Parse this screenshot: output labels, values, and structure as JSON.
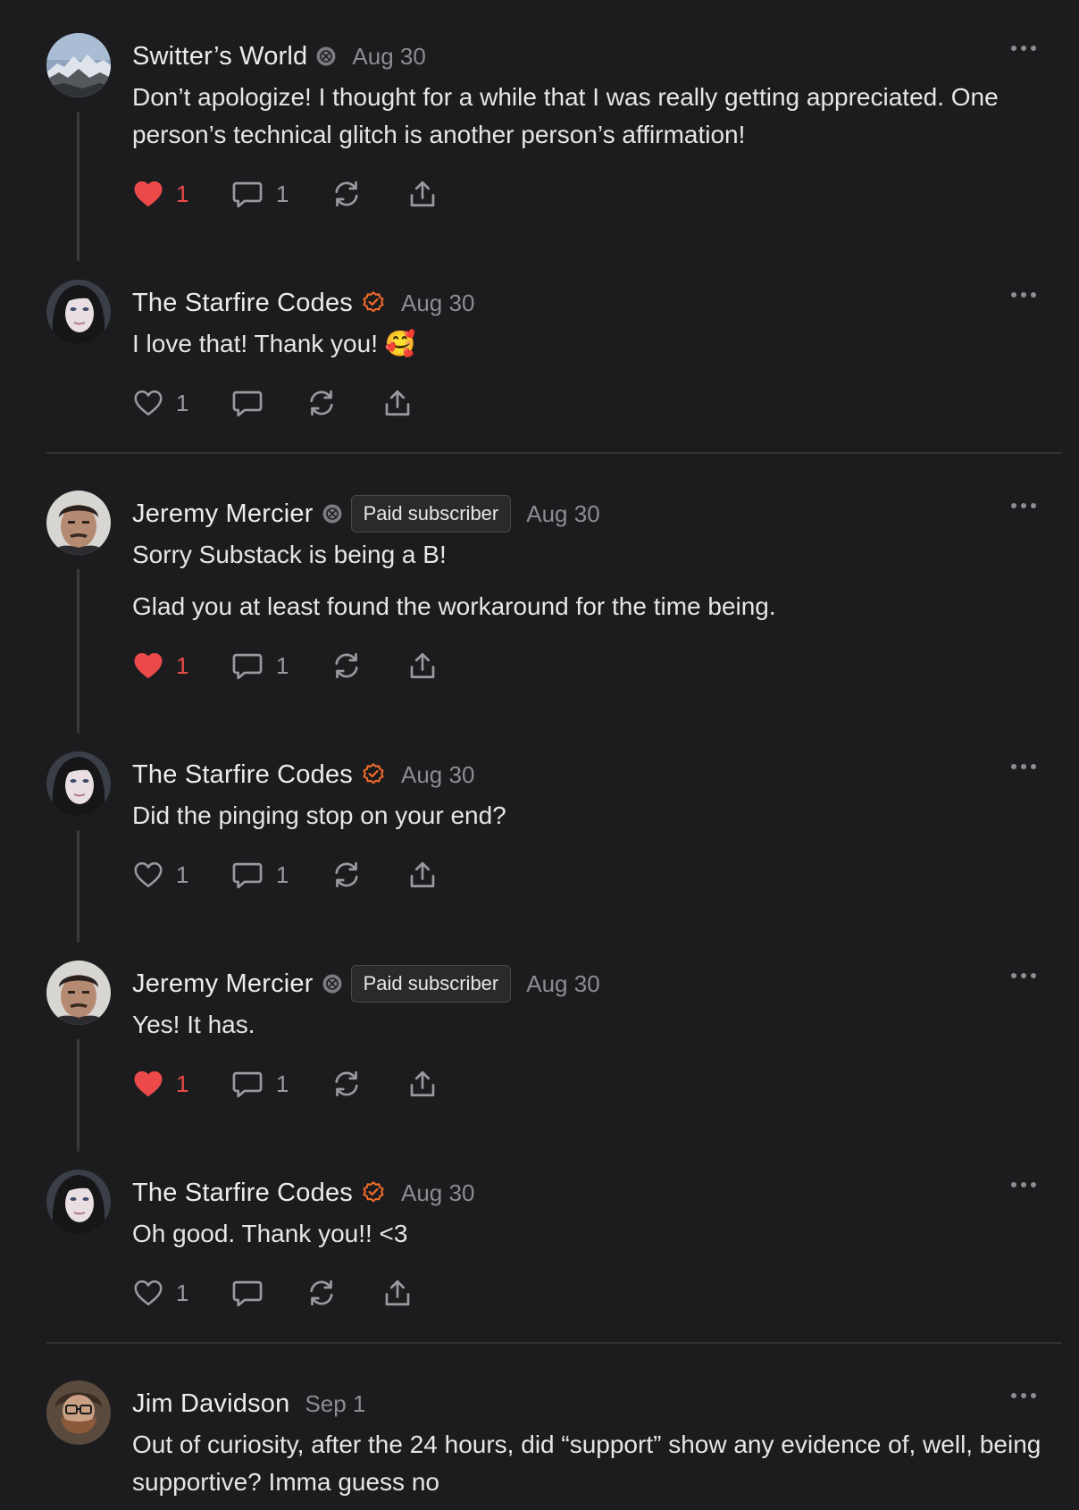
{
  "colors": {
    "background": "#1c1c1e",
    "like_active": "#ec4a4a",
    "verified": "#f06a2a",
    "muted": "#8d8d91"
  },
  "icons": {
    "like": "heart-icon",
    "comment": "speech-bubble-icon",
    "restack": "restack-arrows-icon",
    "share": "share-upload-icon",
    "more": "ellipsis-icon",
    "verified": "verified-check-icon",
    "creator_badge": "substack-badge-icon"
  },
  "comments": [
    {
      "author": "Switter’s World",
      "date": "Aug 30",
      "badge": "substack",
      "body": [
        "Don’t apologize! I thought for a while that I was really getting appreciated. One person’s technical glitch is another person’s affirmation!"
      ],
      "likes": "1",
      "liked": true,
      "replies": "1"
    },
    {
      "author": "The Starfire Codes",
      "date": "Aug 30",
      "badge": "verified",
      "body": [
        "I love that! Thank you! 🥰"
      ],
      "likes": "1",
      "liked": false
    },
    {
      "author": "Jeremy Mercier",
      "date": "Aug 30",
      "badge": "substack",
      "pill": "Paid subscriber",
      "body": [
        "Sorry Substack is being a B!",
        "Glad you at least found the workaround for the time being."
      ],
      "likes": "1",
      "liked": true,
      "replies": "1"
    },
    {
      "author": "The Starfire Codes",
      "date": "Aug 30",
      "badge": "verified",
      "body": [
        "Did the pinging stop on your end?"
      ],
      "likes": "1",
      "liked": false,
      "replies": "1"
    },
    {
      "author": "Jeremy Mercier",
      "date": "Aug 30",
      "badge": "substack",
      "pill": "Paid subscriber",
      "body": [
        "Yes! It has."
      ],
      "likes": "1",
      "liked": true,
      "replies": "1"
    },
    {
      "author": "The Starfire Codes",
      "date": "Aug 30",
      "badge": "verified",
      "body": [
        "Oh good. Thank you!! <3"
      ],
      "likes": "1",
      "liked": false
    },
    {
      "author": "Jim Davidson",
      "date": "Sep 1",
      "body": [
        "Out of curiosity, after the 24 hours, did “support” show any evidence of, well, being supportive? Imma guess no"
      ]
    }
  ]
}
